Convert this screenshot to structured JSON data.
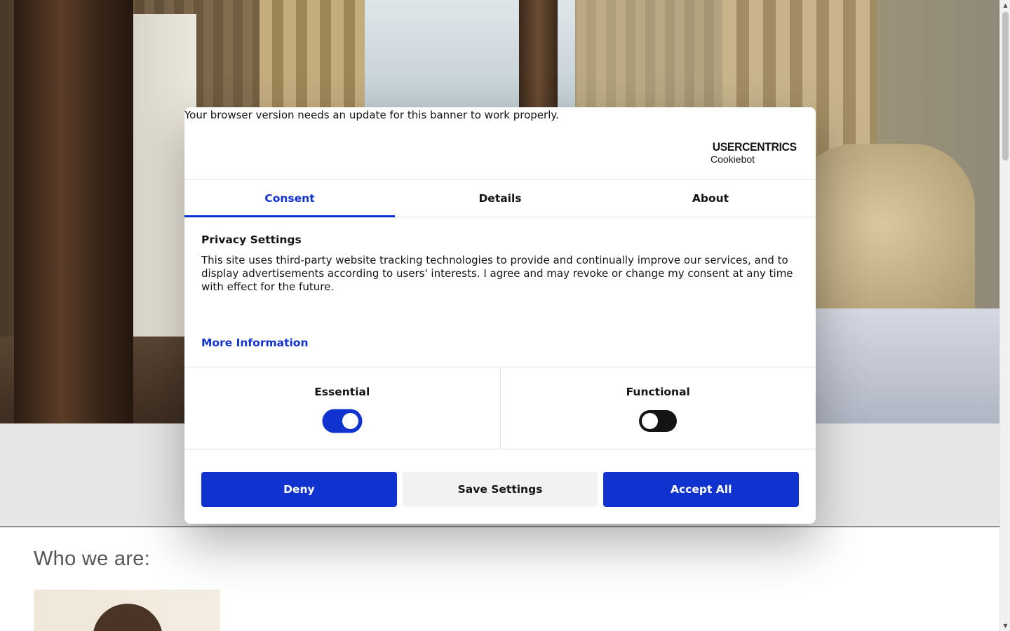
{
  "background": {
    "section_title": "Who we are:"
  },
  "banner": {
    "browser_warning": "Your browser version needs an update for this banner to work properly.",
    "brand": {
      "name": "USERCENTRICS",
      "product": "Cookiebot",
      "icon": "shield-check-icon"
    },
    "tabs": [
      {
        "label": "Consent",
        "active": true
      },
      {
        "label": "Details",
        "active": false
      },
      {
        "label": "About",
        "active": false
      }
    ],
    "heading": "Privacy Settings",
    "description": "This site uses third-party website tracking technologies to provide and continually improve our services, and to display advertisements according to users' interests. I agree and may revoke or change my consent at any time with effect for the future.",
    "more_info": "More Information",
    "categories": [
      {
        "label": "Essential",
        "enabled": true
      },
      {
        "label": "Functional",
        "enabled": false
      }
    ],
    "buttons": {
      "deny": "Deny",
      "save": "Save Settings",
      "accept": "Accept All"
    }
  },
  "colors": {
    "accent": "#1032cf",
    "text": "#141414",
    "secondary_button": "#f2f2f2"
  }
}
